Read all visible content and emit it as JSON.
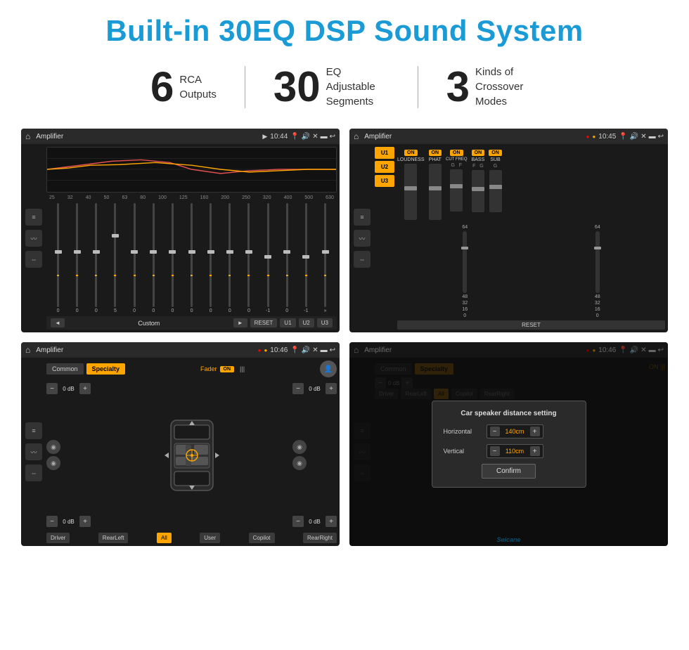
{
  "page": {
    "title": "Built-in 30EQ DSP Sound System",
    "stats": [
      {
        "number": "6",
        "label_line1": "RCA",
        "label_line2": "Outputs"
      },
      {
        "number": "30",
        "label_line1": "EQ Adjustable",
        "label_line2": "Segments"
      },
      {
        "number": "3",
        "label_line1": "Kinds of",
        "label_line2": "Crossover Modes"
      }
    ],
    "screens": [
      {
        "id": "screen1",
        "title": "Amplifier",
        "time": "10:44",
        "eq_freqs": [
          "25",
          "32",
          "40",
          "50",
          "63",
          "80",
          "100",
          "125",
          "160",
          "200",
          "250",
          "320",
          "400",
          "500",
          "630"
        ],
        "eq_values": [
          "0",
          "0",
          "0",
          "5",
          "0",
          "0",
          "0",
          "0",
          "0",
          "0",
          "0",
          "-1",
          "0",
          "-1"
        ],
        "bottom_label": "Custom",
        "buttons": [
          "RESET",
          "U1",
          "U2",
          "U3"
        ]
      },
      {
        "id": "screen2",
        "title": "Amplifier",
        "time": "10:45",
        "tabs": [
          "U1",
          "U2",
          "U3"
        ],
        "controls": [
          {
            "on": true,
            "label": "LOUDNESS"
          },
          {
            "on": true,
            "label": "PHAT"
          },
          {
            "on": true,
            "label": "CUT FREQ"
          },
          {
            "on": true,
            "label": "BASS"
          },
          {
            "on": true,
            "label": "SUB"
          }
        ],
        "reset_label": "RESET"
      },
      {
        "id": "screen3",
        "title": "Amplifier",
        "time": "10:46",
        "tabs": [
          "Common",
          "Specialty"
        ],
        "active_tab": "Specialty",
        "fader_label": "Fader",
        "on_label": "ON",
        "channels": [
          "0 dB",
          "0 dB",
          "0 dB",
          "0 dB"
        ],
        "buttons": [
          "Driver",
          "RearLeft",
          "All",
          "User",
          "Copilot",
          "RearRight"
        ]
      },
      {
        "id": "screen4",
        "title": "Amplifier",
        "time": "10:46",
        "tabs": [
          "Common",
          "Specialty"
        ],
        "dialog": {
          "title": "Car speaker distance setting",
          "horizontal_label": "Horizontal",
          "horizontal_value": "140cm",
          "vertical_label": "Vertical",
          "vertical_value": "110cm",
          "confirm_label": "Confirm"
        },
        "buttons": [
          "Driver",
          "RearLeft",
          "Copilot",
          "RearRight"
        ]
      }
    ],
    "watermark": "Seicane"
  }
}
